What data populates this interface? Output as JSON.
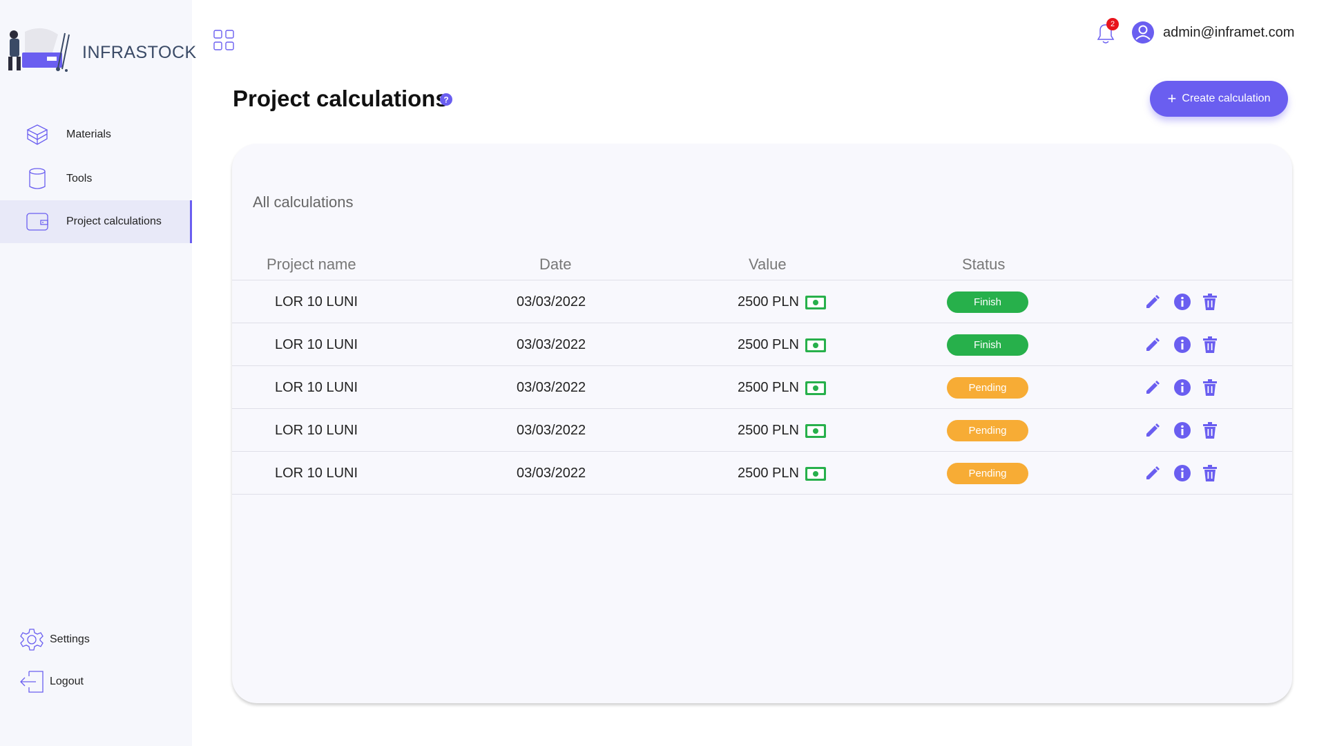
{
  "app": {
    "brand": "INFRASTOCK"
  },
  "sidebar": {
    "items": [
      {
        "label": "Materials",
        "icon": "cube-icon"
      },
      {
        "label": "Tools",
        "icon": "cylinder-icon"
      },
      {
        "label": "Project calculations",
        "icon": "wallet-icon",
        "active": true
      }
    ],
    "bottom": [
      {
        "label": "Settings",
        "icon": "gear-icon"
      },
      {
        "label": "Logout",
        "icon": "logout-icon"
      }
    ]
  },
  "header": {
    "notification_count": "2",
    "user_email": "admin@inframet.com"
  },
  "page": {
    "title": "Project calculations",
    "create_label": "Create calculation"
  },
  "table": {
    "title": "All calculations",
    "columns": [
      "Project name",
      "Date",
      "Value",
      "Status"
    ],
    "rows": [
      {
        "project": "LOR 10 LUNI",
        "date": "03/03/2022",
        "value": "2500 PLN",
        "status": "Finish"
      },
      {
        "project": "LOR 10 LUNI",
        "date": "03/03/2022",
        "value": "2500 PLN",
        "status": "Finish"
      },
      {
        "project": "LOR 10 LUNI",
        "date": "03/03/2022",
        "value": "2500 PLN",
        "status": "Pending"
      },
      {
        "project": "LOR 10 LUNI",
        "date": "03/03/2022",
        "value": "2500 PLN",
        "status": "Pending"
      },
      {
        "project": "LOR 10 LUNI",
        "date": "03/03/2022",
        "value": "2500 PLN",
        "status": "Pending"
      }
    ]
  },
  "colors": {
    "accent": "#6a5ef0",
    "finish": "#27b04b",
    "pending": "#f7ac35",
    "badge": "#e8141c"
  }
}
